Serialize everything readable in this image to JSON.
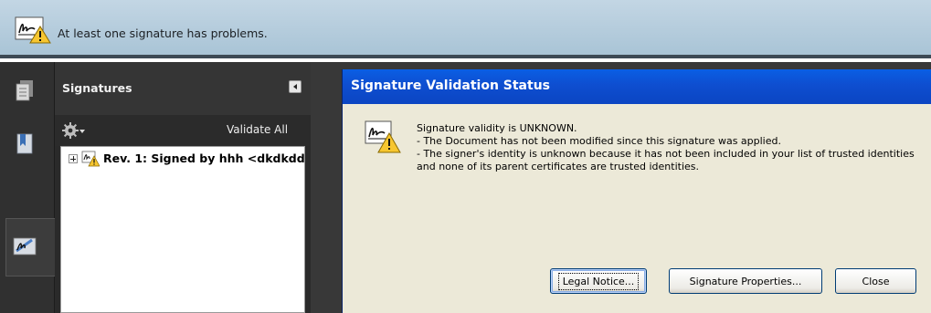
{
  "message_bar": {
    "text": "At least one signature has problems.",
    "icon": "signature-warning-icon"
  },
  "nav_strip": {
    "items": [
      {
        "name": "pages-icon",
        "selected": false
      },
      {
        "name": "bookmarks-icon",
        "selected": false
      },
      {
        "name": "signatures-icon",
        "selected": true
      }
    ]
  },
  "signatures_panel": {
    "title": "Signatures",
    "options_icon": "gear-icon",
    "validate_all_label": "Validate All",
    "tree": [
      {
        "label": "Rev. 1: Signed by hhh <dkdkdd",
        "icon": "signature-warning-icon",
        "expanded": false
      }
    ]
  },
  "dialog": {
    "title": "Signature Validation Status",
    "icon": "signature-warning-icon",
    "lines": [
      "Signature validity is UNKNOWN.",
      "- The Document has not been modified since this signature was applied.",
      "- The signer's identity is unknown because it has not been included in your list of trusted identities and none of its parent certificates are trusted identities."
    ],
    "buttons": {
      "legal_notice": "Legal Notice...",
      "signature_properties": "Signature Properties...",
      "close": "Close"
    }
  },
  "colors": {
    "dialog_title_bar": "#0b4fd2",
    "dialog_background": "#ece9d8",
    "panel_background": "#2a2a2a",
    "message_bar": "#b6cddc"
  }
}
